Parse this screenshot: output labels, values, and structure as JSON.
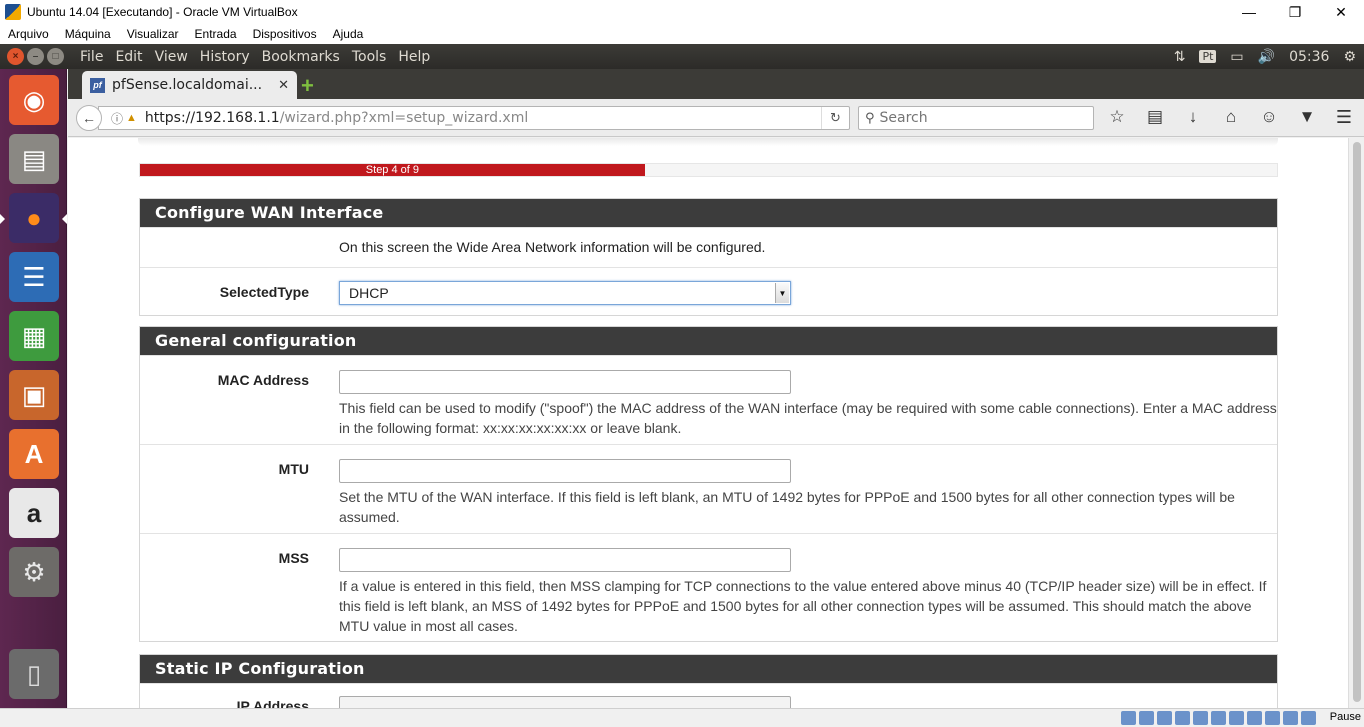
{
  "vbox": {
    "title": "Ubuntu 14.04 [Executando] - Oracle VM VirtualBox",
    "menu": [
      "Arquivo",
      "Máquina",
      "Visualizar",
      "Entrada",
      "Dispositivos",
      "Ajuda"
    ],
    "status_right": "Pause"
  },
  "panel": {
    "menus": [
      "File",
      "Edit",
      "View",
      "History",
      "Bookmarks",
      "Tools",
      "Help"
    ],
    "keyboard": "Pt",
    "clock": "05:36"
  },
  "browser": {
    "tab_title": "pfSense.localdomai...",
    "url_host": "https://192.168.1.1",
    "url_path": "/wizard.php?xml=setup_wizard.xml",
    "search_placeholder": "Search"
  },
  "wizard": {
    "progress_label": "Step 4 of 9",
    "progress_fraction": 0.444,
    "wan": {
      "heading": "Configure WAN Interface",
      "intro": "On this screen the Wide Area Network information will be configured.",
      "selected_type_label": "SelectedType",
      "selected_type_value": "DHCP"
    },
    "general": {
      "heading": "General configuration",
      "mac_label": "MAC Address",
      "mac_value": "",
      "mac_help": "This field can be used to modify (\"spoof\") the MAC address of the WAN interface (may be required with some cable connections). Enter a MAC address in the following format: xx:xx:xx:xx:xx:xx or leave blank.",
      "mtu_label": "MTU",
      "mtu_value": "",
      "mtu_help": "Set the MTU of the WAN interface. If this field is left blank, an MTU of 1492 bytes for PPPoE and 1500 bytes for all other connection types will be assumed.",
      "mss_label": "MSS",
      "mss_value": "",
      "mss_help": "If a value is entered in this field, then MSS clamping for TCP connections to the value entered above minus 40 (TCP/IP header size) will be in effect. If this field is left blank, an MSS of 1492 bytes for PPPoE and 1500 bytes for all other connection types will be assumed. This should match the above MTU value in most all cases."
    },
    "static": {
      "heading": "Static IP Configuration",
      "ip_label": "IP Address"
    }
  },
  "colors": {
    "progress_red": "#c0181d",
    "panel_heading": "#3c3c3c",
    "launcher": "#5e2750"
  }
}
